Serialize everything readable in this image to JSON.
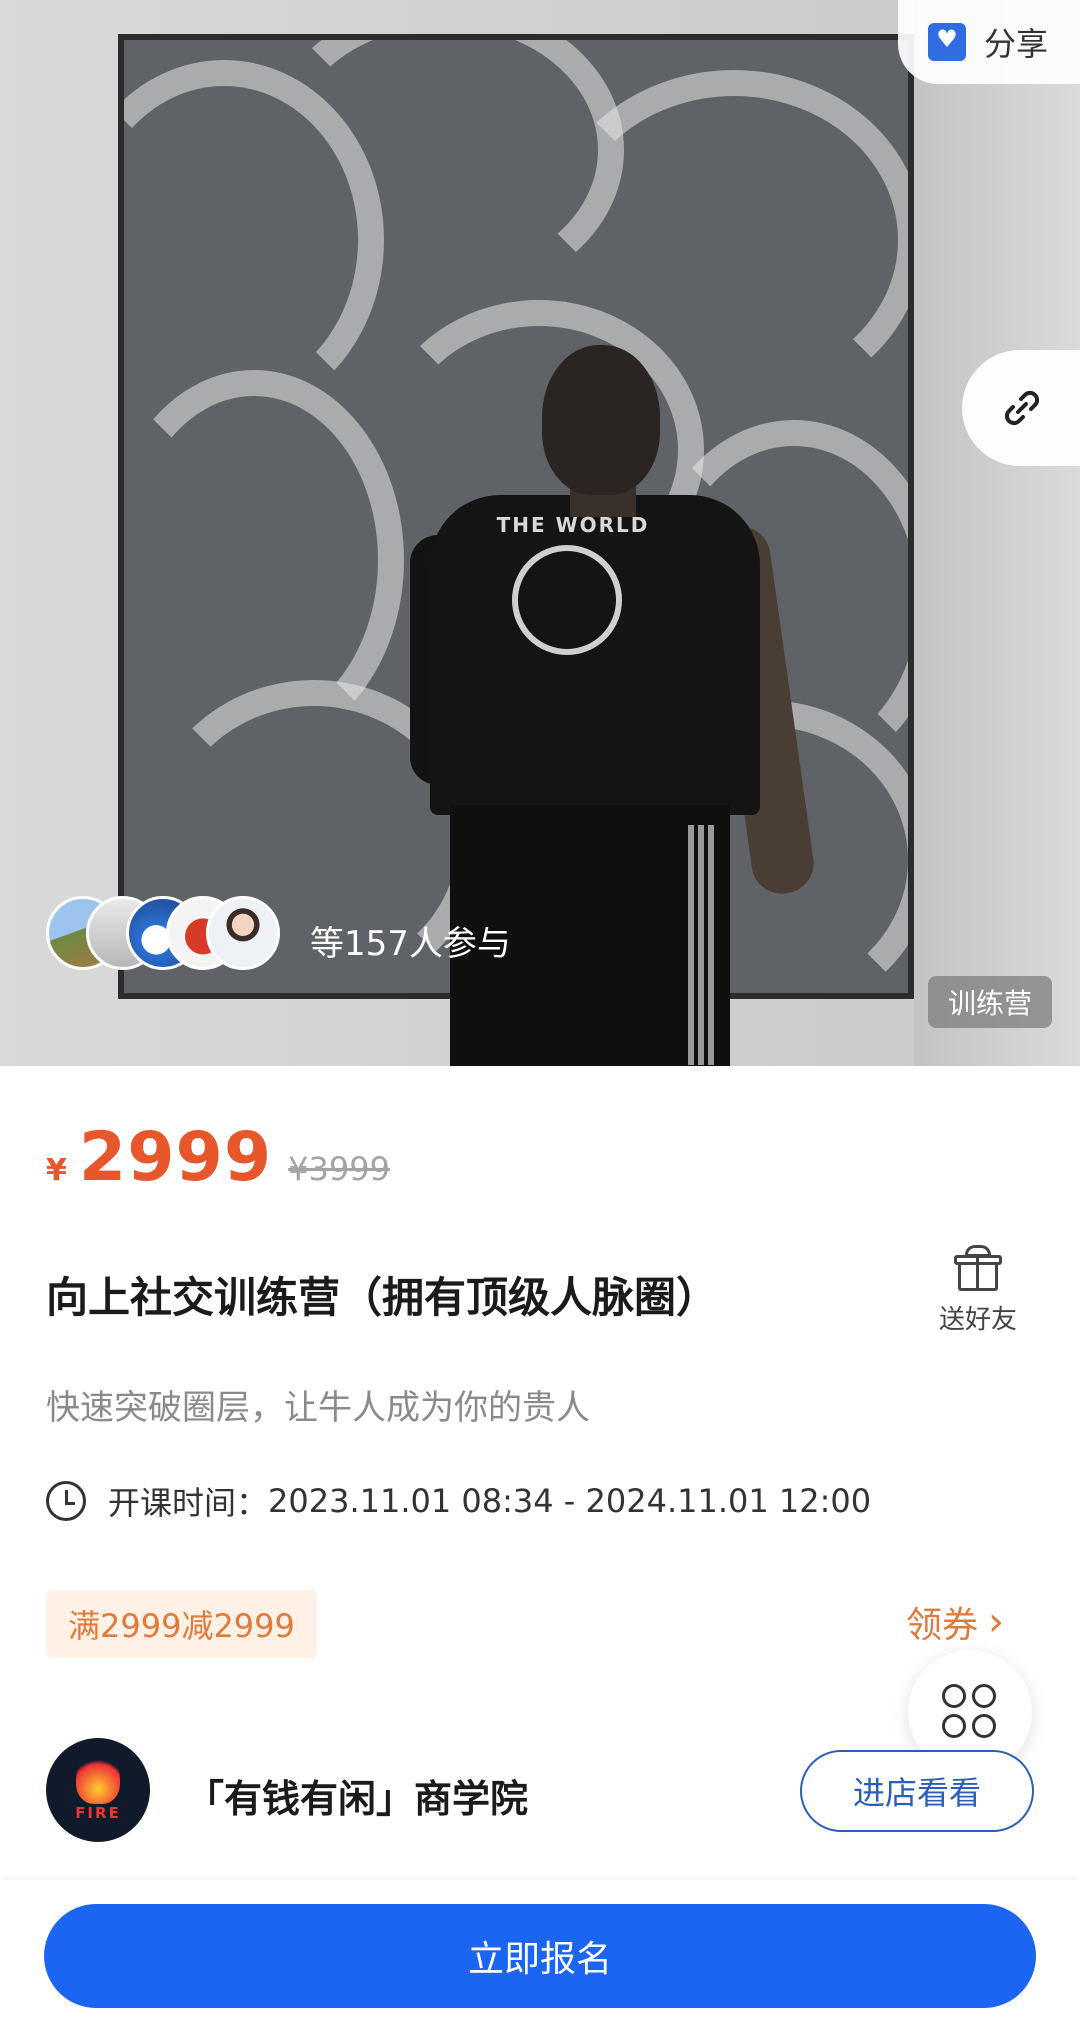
{
  "hero": {
    "share_label": "分享",
    "participants_text": "等157人参与",
    "category_tag": "训练营",
    "shirt_text": "THE WORLD",
    "icons": {
      "share": "share-heart-icon",
      "link": "link-icon"
    }
  },
  "product": {
    "currency": "¥",
    "price": "2999",
    "original_price": "¥3999",
    "title": "向上社交训练营（拥有顶级人脉圈）",
    "subtitle": "快速突破圈层，让牛人成为你的贵人",
    "time_label": "开课时间：",
    "time_value": "2023.11.01 08:34 - 2024.11.01 12:00",
    "gift_label": "送好友"
  },
  "coupon": {
    "badge": "满2999减2999",
    "link_label": "领券"
  },
  "shop": {
    "logo_text": "FIRE",
    "name": "「有钱有闲」商学院",
    "visit_label": "进店看看"
  },
  "bottom": {
    "signup_label": "立即报名"
  },
  "colors": {
    "price": "#e8572b",
    "coupon": "#e07a3a",
    "primary": "#1c64f2",
    "shop_button": "#2a5fb8"
  }
}
